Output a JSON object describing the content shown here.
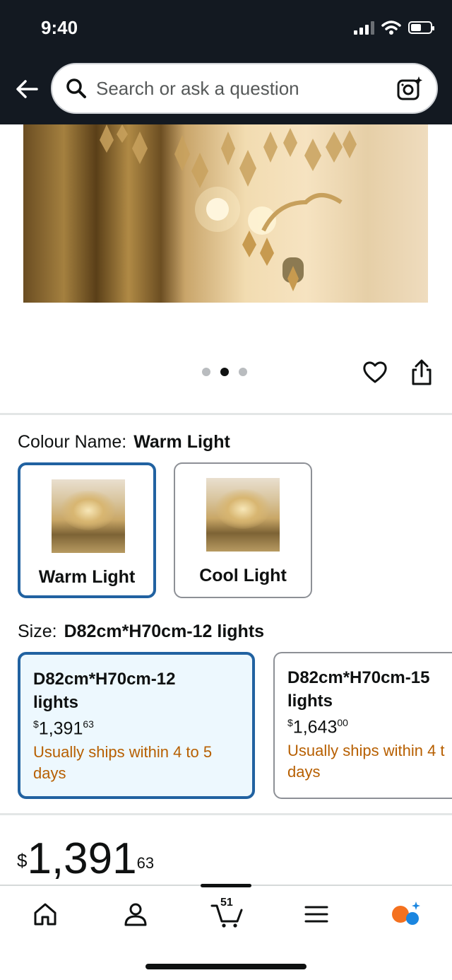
{
  "status_bar": {
    "time": "9:40"
  },
  "header": {
    "search_placeholder": "Search or ask a question"
  },
  "gallery": {
    "page_count": 3,
    "active_index": 1
  },
  "colour": {
    "label": "Colour Name:",
    "selected": "Warm Light",
    "options": [
      {
        "label": "Warm Light",
        "selected": true
      },
      {
        "label": "Cool Light",
        "selected": false
      }
    ]
  },
  "size": {
    "label": "Size:",
    "selected": "D82cm*H70cm-12 lights",
    "options": [
      {
        "name_line1": "D82cm*H70cm-12",
        "name_line2": "lights",
        "currency": "$",
        "whole": "1,391",
        "cents": "63",
        "ship_line1": "Usually ships within 4 to 5",
        "ship_line2": "days",
        "selected": true
      },
      {
        "name_line1": "D82cm*H70cm-15",
        "name_line2": "lights",
        "currency": "$",
        "whole": "1,643",
        "cents": "00",
        "ship_line1": "Usually ships within 4 t",
        "ship_line2": "days",
        "selected": false
      }
    ]
  },
  "price": {
    "currency": "$",
    "whole": "1,391",
    "cents": "63"
  },
  "bottom_nav": {
    "cart_count": "51"
  },
  "colors": {
    "header_bg": "#131921",
    "selected_border": "#2162a1",
    "ship_text": "#b75f00",
    "selected_bg": "#edf8fe"
  }
}
